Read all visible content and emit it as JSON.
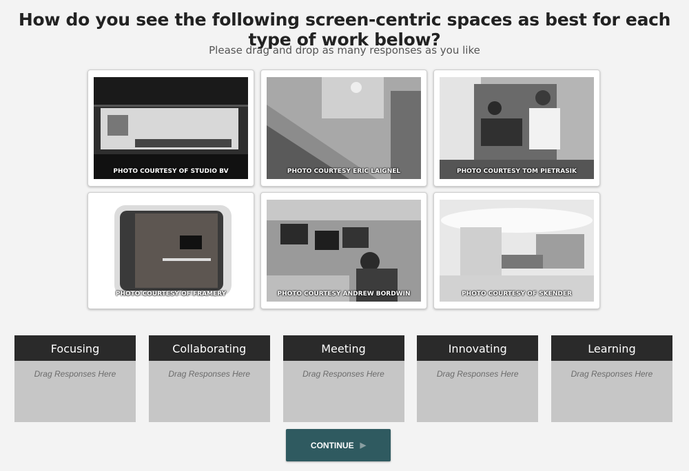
{
  "question": {
    "title": "How do you see the following screen-centric spaces as best for each type of work below?",
    "instruction": "Please drag and drop as many responses as you like"
  },
  "responses": [
    {
      "credit": "PHOTO COURTESY OF STUDIO BV"
    },
    {
      "credit": "PHOTO COURTESY ERIC LAIGNEL"
    },
    {
      "credit": "PHOTO COURTESY TOM PIETRASIK"
    },
    {
      "credit": "PHOTO COURTESY OF FRAMERY"
    },
    {
      "credit": "PHOTO COURTESY ANDREW BORDWIN"
    },
    {
      "credit": "PHOTO COURTESY OF SKENDER"
    }
  ],
  "categories": [
    {
      "label": "Focusing",
      "hint": "Drag Responses Here"
    },
    {
      "label": "Collaborating",
      "hint": "Drag Responses Here"
    },
    {
      "label": "Meeting",
      "hint": "Drag Responses Here"
    },
    {
      "label": "Innovating",
      "hint": "Drag Responses Here"
    },
    {
      "label": "Learning",
      "hint": "Drag Responses Here"
    }
  ],
  "continue_button": {
    "label": "CONTINUE",
    "icon": "play-icon"
  }
}
